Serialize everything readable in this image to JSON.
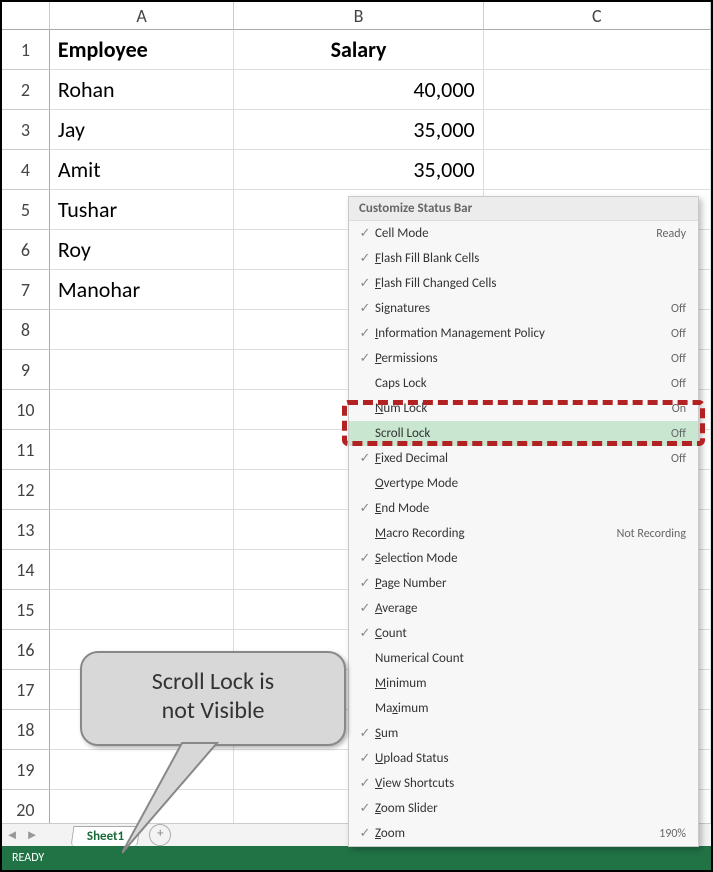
{
  "columns": [
    "A",
    "B",
    "C"
  ],
  "header_row": {
    "a": "Employee",
    "b": "Salary"
  },
  "data_rows": [
    {
      "n": "1",
      "a": "Employee",
      "b": "Salary",
      "bold": true,
      "b_align": "center"
    },
    {
      "n": "2",
      "a": "Rohan",
      "b": "40,000",
      "b_align": "right"
    },
    {
      "n": "3",
      "a": "Jay",
      "b": "35,000",
      "b_align": "right"
    },
    {
      "n": "4",
      "a": "Amit",
      "b": "35,000",
      "b_align": "right"
    },
    {
      "n": "5",
      "a": "Tushar",
      "b": ""
    },
    {
      "n": "6",
      "a": "Roy",
      "b": ""
    },
    {
      "n": "7",
      "a": "Manohar",
      "b": ""
    }
  ],
  "empty_rows": [
    "8",
    "9",
    "10",
    "11",
    "12",
    "13",
    "14",
    "15",
    "16",
    "17",
    "18",
    "19",
    "20"
  ],
  "sheet_tab": "Sheet1",
  "status_ready": "READY",
  "menu": {
    "title": "Customize Status Bar",
    "items": [
      {
        "check": true,
        "label": "Cell Mode",
        "u": "",
        "status": "Ready"
      },
      {
        "check": true,
        "label": "Flash Fill Blank Cells",
        "u": "F",
        "status": ""
      },
      {
        "check": true,
        "label": "Flash Fill Changed Cells",
        "u": "F",
        "status": ""
      },
      {
        "check": true,
        "label": "Signatures",
        "u": "",
        "status": "Off"
      },
      {
        "check": true,
        "label": "Information Management Policy",
        "u": "I",
        "status": "Off"
      },
      {
        "check": true,
        "label": "Permissions",
        "u": "P",
        "status": "Off"
      },
      {
        "check": false,
        "label": "Caps Lock",
        "u": "",
        "status": "Off"
      },
      {
        "check": false,
        "label": "Num Lock",
        "u": "N",
        "status": "On"
      },
      {
        "check": false,
        "label": "Scroll Lock",
        "u": "",
        "status": "Off",
        "highlight": true
      },
      {
        "check": true,
        "label": "Fixed Decimal",
        "u": "F",
        "status": "Off"
      },
      {
        "check": false,
        "label": "Overtype Mode",
        "u": "O",
        "status": ""
      },
      {
        "check": true,
        "label": "End Mode",
        "u": "E",
        "status": ""
      },
      {
        "check": false,
        "label": "Macro Recording",
        "u": "M",
        "status": "Not Recording"
      },
      {
        "check": true,
        "label": "Selection Mode",
        "u": "S",
        "status": ""
      },
      {
        "check": true,
        "label": "Page Number",
        "u": "P",
        "status": ""
      },
      {
        "check": true,
        "label": "Average",
        "u": "A",
        "status": ""
      },
      {
        "check": true,
        "label": "Count",
        "u": "C",
        "status": ""
      },
      {
        "check": false,
        "label": "Numerical Count",
        "u": "",
        "status": ""
      },
      {
        "check": false,
        "label": "Minimum",
        "u": "M",
        "status": ""
      },
      {
        "check": false,
        "label": "Maximum",
        "u": "x",
        "status": ""
      },
      {
        "check": true,
        "label": "Sum",
        "u": "S",
        "status": ""
      },
      {
        "check": true,
        "label": "Upload Status",
        "u": "U",
        "status": ""
      },
      {
        "check": true,
        "label": "View Shortcuts",
        "u": "V",
        "status": ""
      },
      {
        "check": true,
        "label": "Zoom Slider",
        "u": "Z",
        "status": ""
      },
      {
        "check": true,
        "label": "Zoom",
        "u": "Z",
        "status": "190%"
      }
    ]
  },
  "callout_line1": "Scroll Lock is",
  "callout_line2": "not Visible"
}
